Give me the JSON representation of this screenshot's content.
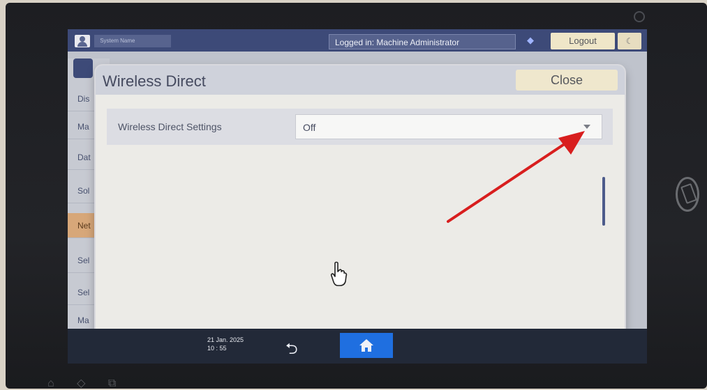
{
  "topbar": {
    "system_name": " System Name",
    "logged_in": "Logged in: Machine Administrator",
    "logout": "Logout",
    "moon_symbol": "☾"
  },
  "left_menu": {
    "items": [
      "Dis",
      "Ma",
      "Dat",
      "Sol",
      "Net",
      "Sel",
      "Sel",
      "Ma"
    ]
  },
  "dialog": {
    "title": "Wireless Direct",
    "close": "Close",
    "setting_label": "Wireless Direct Settings",
    "setting_value": "Off"
  },
  "taskbar": {
    "date": "21 Jan. 2025",
    "time": "10 : 55"
  },
  "colors": {
    "topbar": "#3d4a78",
    "home_accent": "#1f6fe0",
    "arrow": "#d81e1e",
    "active_menu": "#d7a779"
  },
  "icons": [
    "user-icon",
    "info-icon",
    "moon-icon",
    "tools-icon",
    "chevron-down-icon",
    "back-icon",
    "home-icon",
    "hand-pointer-icon",
    "arrow-annotation-icon",
    "rotate-icon"
  ]
}
